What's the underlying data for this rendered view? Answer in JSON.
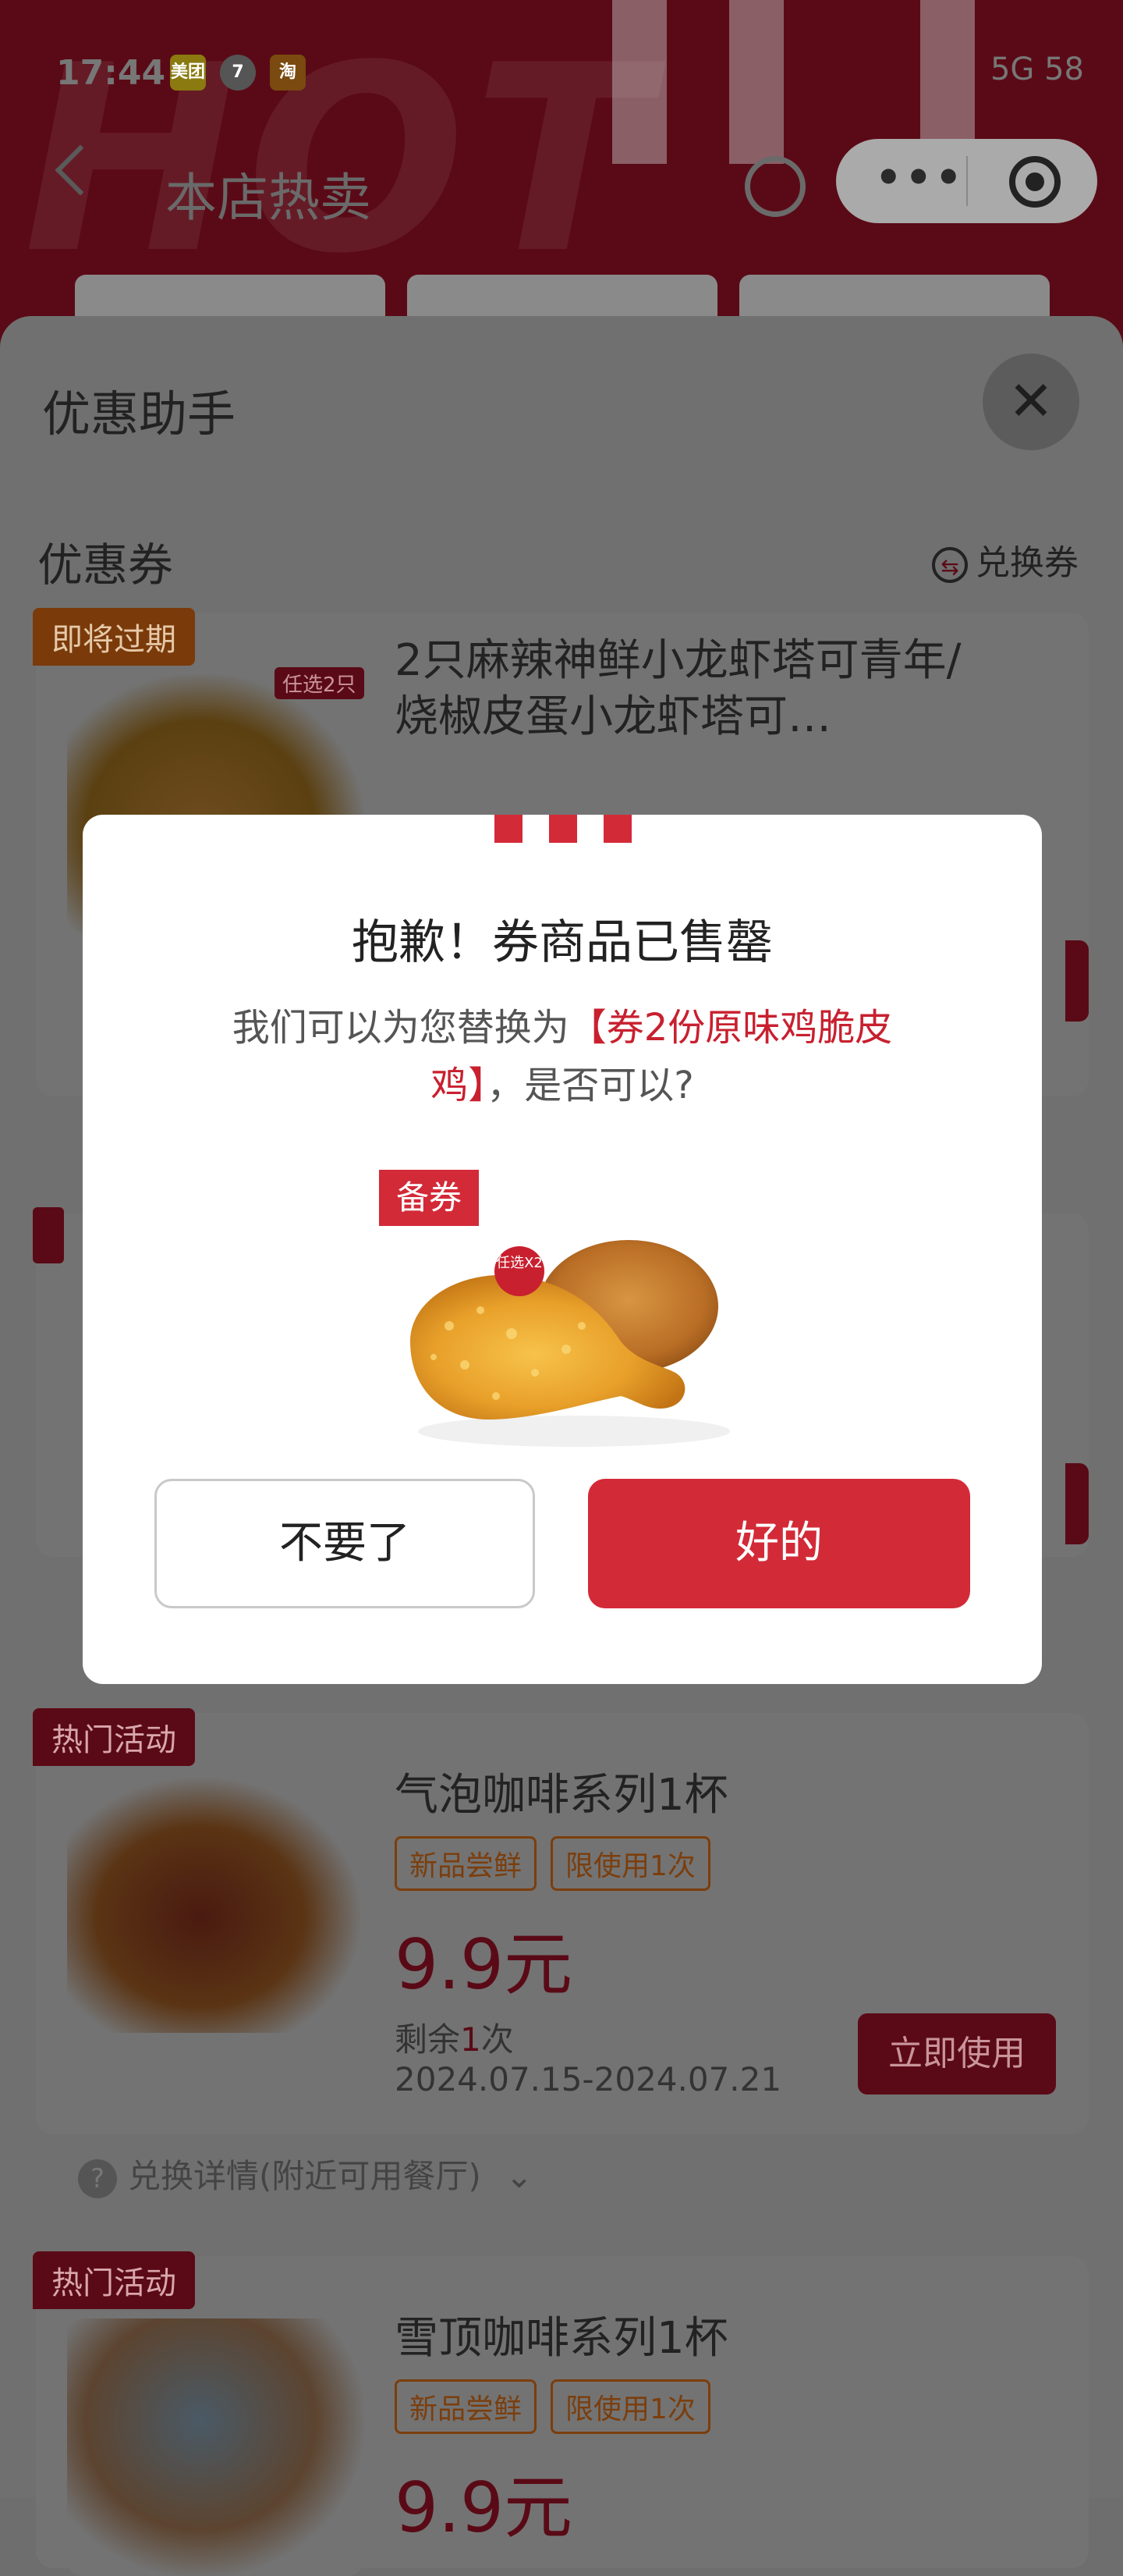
{
  "status_bar": {
    "time": "17:44",
    "app_icons": [
      "美团",
      "7",
      "淘"
    ],
    "right": "5G  58"
  },
  "nav": {
    "title": "本店热卖"
  },
  "sheet": {
    "title": "优惠助手",
    "section_title": "优惠券",
    "exchange_label": "兑换券",
    "coupons": [
      {
        "tag": "即将过期",
        "badge": "任选2只",
        "name": "2只麻辣神鲜小龙虾塔可青年/烧椒皮蛋小龙虾塔可…"
      },
      {
        "tag": "热门活动",
        "name": "气泡咖啡系列1杯",
        "chips": [
          "新品尝鲜",
          "限使用1次"
        ],
        "price": "9.9元",
        "remain_prefix": "剩余",
        "remain_num": "1",
        "remain_suffix": "次",
        "date": "2024.07.15-2024.07.21",
        "use_label": "立即使用",
        "detail_label": "兑换详情(附近可用餐厅)"
      },
      {
        "tag": "热门活动",
        "name": "雪顶咖啡系列1杯",
        "chips": [
          "新品尝鲜",
          "限使用1次"
        ],
        "price": "9.9元"
      }
    ]
  },
  "modal": {
    "title": "抱歉！券商品已售罄",
    "msg_prefix": "我们可以为您替换为",
    "msg_highlight": "【券2份原味鸡脆皮鸡】",
    "msg_suffix": "，是否可以?",
    "backup_tag": "备券",
    "product_badge": "任选X2",
    "decline_label": "不要了",
    "accept_label": "好的"
  },
  "colors": {
    "brand_red": "#d32a38",
    "highlight_red": "#c8202f"
  }
}
